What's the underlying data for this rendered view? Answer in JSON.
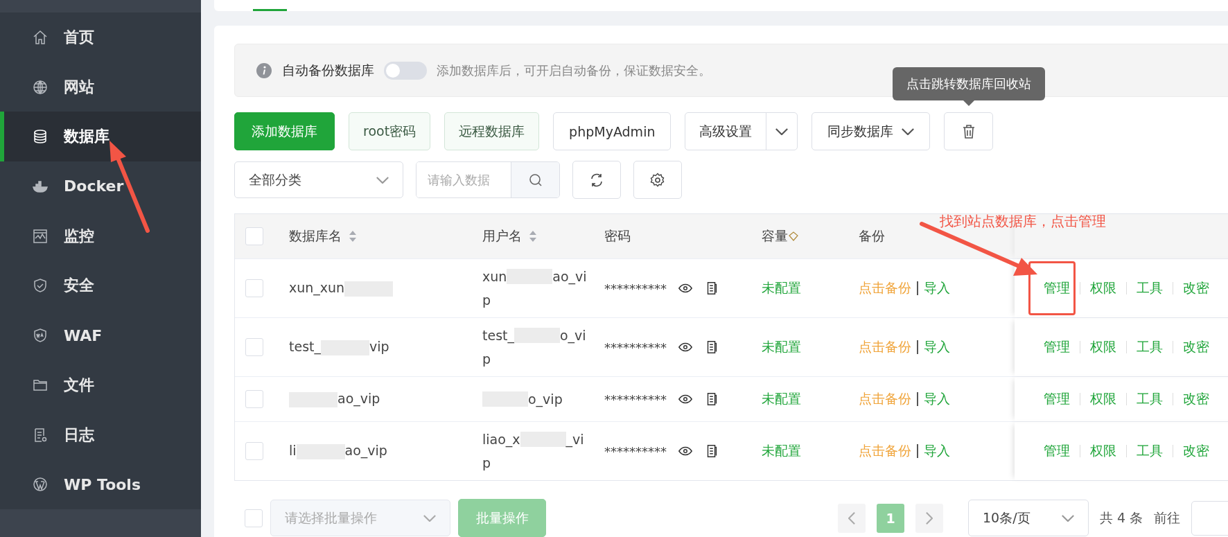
{
  "sidebar": {
    "items": [
      {
        "label": "首页",
        "selected": false
      },
      {
        "label": "网站",
        "selected": false
      },
      {
        "label": "数据库",
        "selected": true
      },
      {
        "label": "Docker",
        "selected": false
      },
      {
        "label": "监控",
        "selected": false
      },
      {
        "label": "安全",
        "selected": false
      },
      {
        "label": "WAF",
        "selected": false
      },
      {
        "label": "文件",
        "selected": false
      },
      {
        "label": "日志",
        "selected": false
      },
      {
        "label": "WP Tools",
        "selected": false
      }
    ]
  },
  "alert": {
    "label": "自动备份数据库",
    "switch_on": false,
    "hint": "添加数据库后，可开启自动备份，保证数据安全。"
  },
  "toolbar": {
    "buttons": [
      {
        "label": "添加数据库",
        "kind": "primary"
      },
      {
        "label": "root密码",
        "kind": "light"
      },
      {
        "label": "远程数据库",
        "kind": "light"
      },
      {
        "label": "phpMyAdmin",
        "kind": "plain"
      },
      {
        "label": "高级设置",
        "kind": "split"
      },
      {
        "label": "同步数据库",
        "kind": "dropdown"
      },
      {
        "kind": "trash"
      }
    ],
    "tooltip": "点击跳转数据库回收站"
  },
  "filters": {
    "category": "全部分类",
    "search_placeholder": "请输入数据"
  },
  "table": {
    "header_checked": false,
    "columns": [
      {
        "label": "数据库名",
        "kind": "sortable"
      },
      {
        "label": "用户名",
        "kind": "sortable"
      },
      {
        "label": "密码",
        "kind": "plain"
      },
      {
        "label": "容量",
        "kind": "premium"
      },
      {
        "label": "备份",
        "kind": "plain"
      }
    ],
    "rows": [
      {
        "checked": false,
        "highlighted": true,
        "name": [
          {
            "kind": "text",
            "text": "xun_xun"
          },
          {
            "kind": "redacted"
          }
        ],
        "user": [
          [
            {
              "kind": "text",
              "text": "xun"
            },
            {
              "kind": "redacted"
            },
            {
              "kind": "text",
              "text": "ao_vi"
            }
          ],
          [
            {
              "kind": "text",
              "text": "p"
            }
          ]
        ],
        "password": "**********",
        "capacity": "未配置",
        "backup": "点击备份",
        "import": "导入",
        "actions": [
          "管理",
          "权限",
          "工具",
          "改密"
        ]
      },
      {
        "checked": false,
        "highlighted": false,
        "name": [
          {
            "kind": "text",
            "text": "test_"
          },
          {
            "kind": "redacted"
          },
          {
            "kind": "text",
            "text": "vip"
          }
        ],
        "user": [
          [
            {
              "kind": "text",
              "text": "test_"
            },
            {
              "kind": "redacted"
            },
            {
              "kind": "text",
              "text": "o_vi"
            }
          ],
          [
            {
              "kind": "text",
              "text": "p"
            }
          ]
        ],
        "password": "**********",
        "capacity": "未配置",
        "backup": "点击备份",
        "import": "导入",
        "actions": [
          "管理",
          "权限",
          "工具",
          "改密"
        ]
      },
      {
        "checked": false,
        "highlighted": false,
        "name": [
          {
            "kind": "redacted"
          },
          {
            "kind": "text",
            "text": "ao_vip"
          }
        ],
        "user": [
          [
            {
              "kind": "redacted"
            },
            {
              "kind": "text",
              "text": "o_vip"
            }
          ]
        ],
        "password": "**********",
        "capacity": "未配置",
        "backup": "点击备份",
        "import": "导入",
        "actions": [
          "管理",
          "权限",
          "工具",
          "改密"
        ]
      },
      {
        "checked": false,
        "highlighted": false,
        "name": [
          {
            "kind": "text",
            "text": "li"
          },
          {
            "kind": "redacted"
          },
          {
            "kind": "text",
            "text": "ao_vip"
          }
        ],
        "user": [
          [
            {
              "kind": "text",
              "text": "liao_x"
            },
            {
              "kind": "redacted"
            },
            {
              "kind": "text",
              "text": "_vi"
            }
          ],
          [
            {
              "kind": "text",
              "text": "p"
            }
          ]
        ],
        "password": "**********",
        "capacity": "未配置",
        "backup": "点击备份",
        "import": "导入",
        "actions": [
          "管理",
          "权限",
          "工具",
          "改密"
        ]
      }
    ]
  },
  "footer": {
    "checked": false,
    "batch_placeholder": "请选择批量操作",
    "batch_button": "批量操作",
    "pages": [
      {
        "label": "1",
        "selected": true
      }
    ],
    "page_size": "10条/页",
    "total": "共 4 条",
    "goto": "前往"
  },
  "annotations": {
    "callout": "找到站点数据库，点击管理"
  }
}
